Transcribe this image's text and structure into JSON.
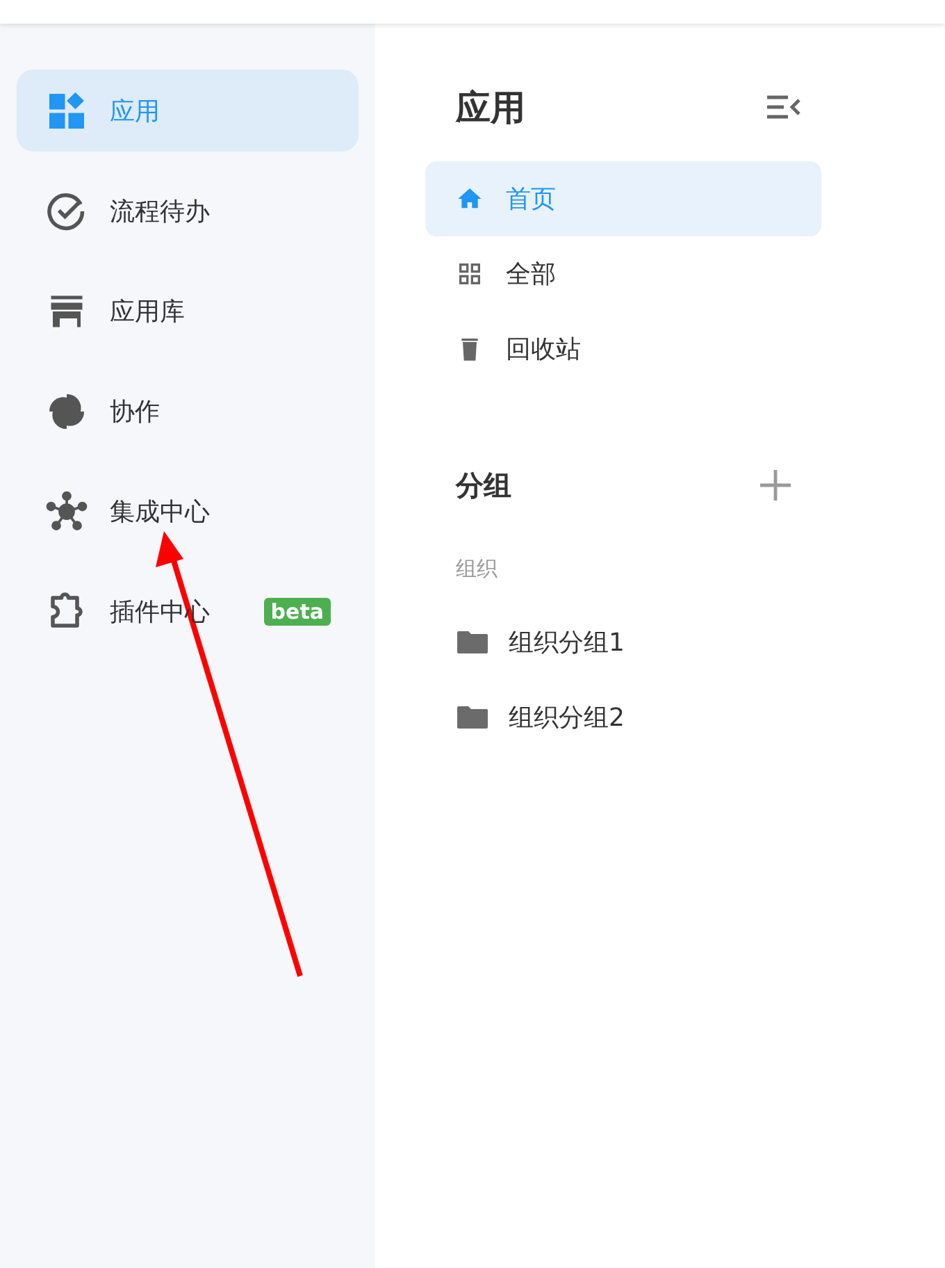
{
  "sidebar": {
    "items": [
      {
        "kind": "apps",
        "label": "应用",
        "selected": true
      },
      {
        "kind": "check",
        "label": "流程待办",
        "selected": false
      },
      {
        "kind": "store",
        "label": "应用库",
        "selected": false
      },
      {
        "kind": "pinwheel",
        "label": "协作",
        "selected": false
      },
      {
        "kind": "hub",
        "label": "集成中心",
        "selected": false
      },
      {
        "kind": "puzzle",
        "label": "插件中心",
        "selected": false,
        "badge": "beta"
      }
    ]
  },
  "panel": {
    "title": "应用",
    "nav": [
      {
        "kind": "home",
        "label": "首页",
        "selected": true
      },
      {
        "kind": "grid",
        "label": "全部",
        "selected": false
      },
      {
        "kind": "trash",
        "label": "回收站",
        "selected": false
      }
    ],
    "groups_title": "分组",
    "org_label": "组织",
    "groups": [
      {
        "label": "组织分组1"
      },
      {
        "label": "组织分组2"
      }
    ]
  },
  "annotation": {
    "kind": "arrow"
  }
}
